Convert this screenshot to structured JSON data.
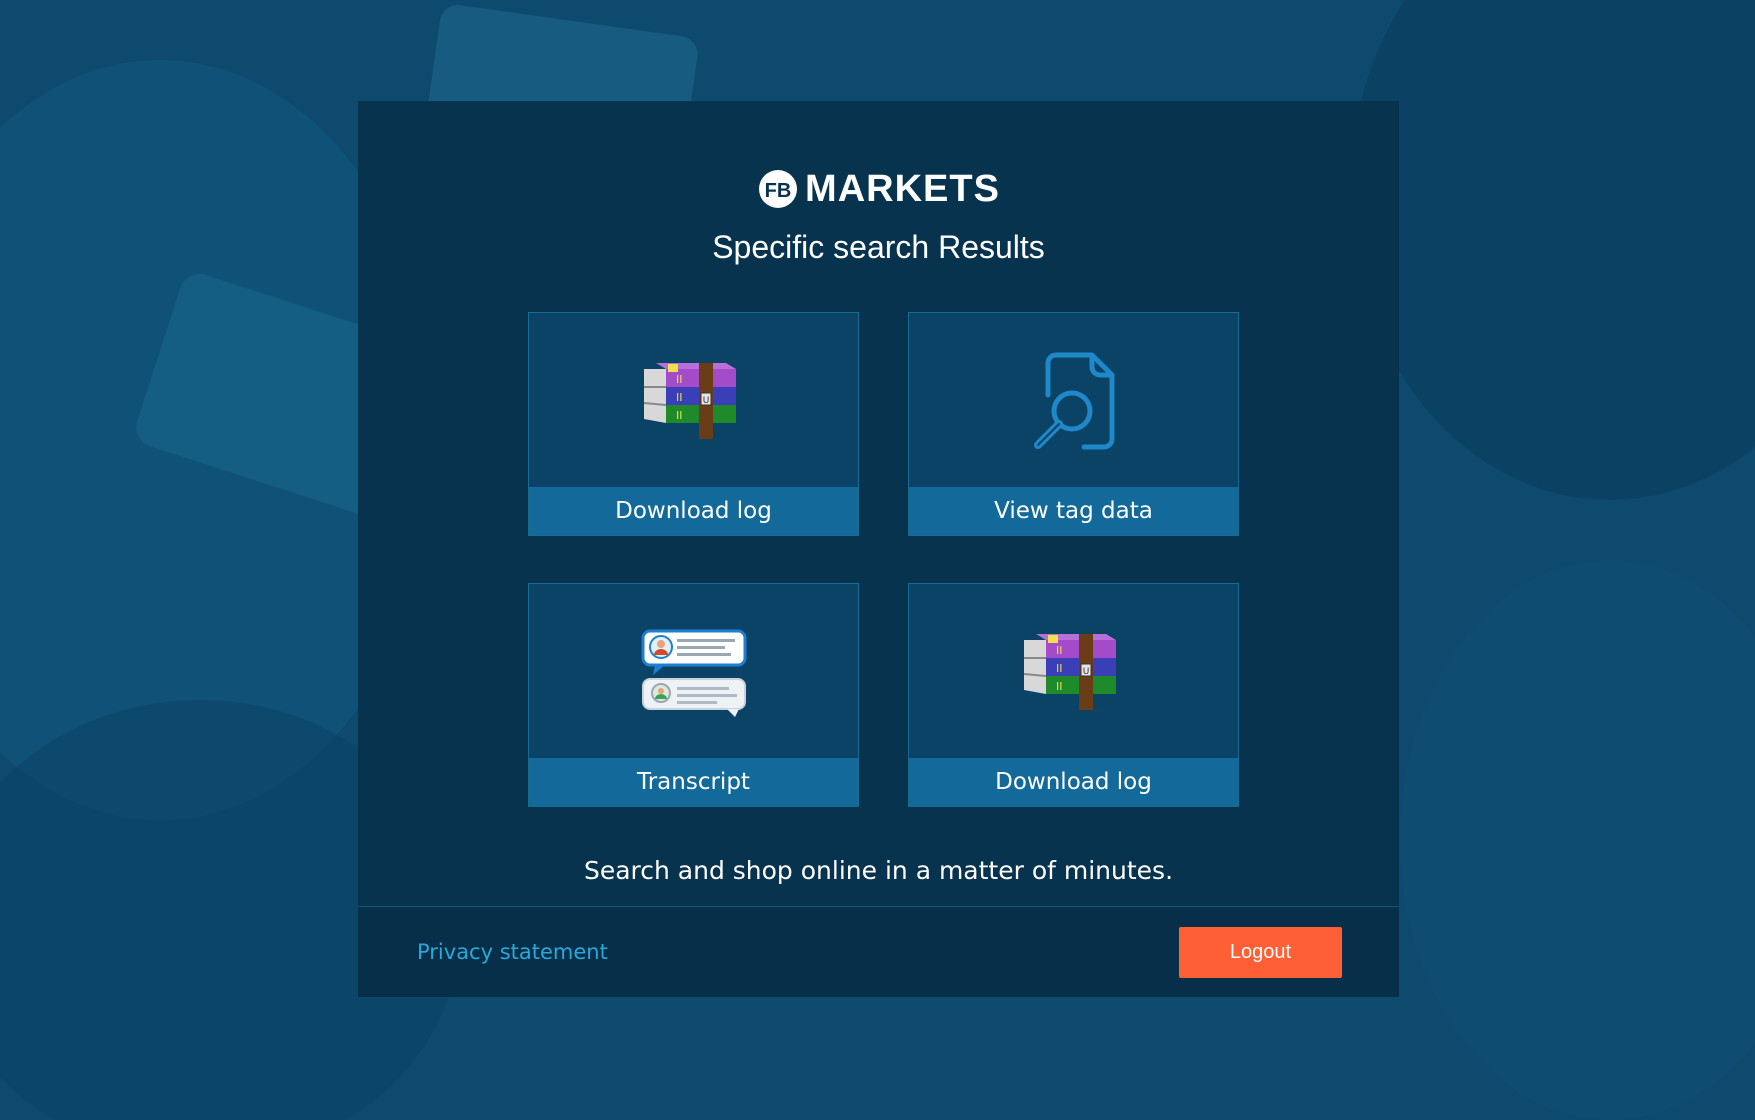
{
  "brand": {
    "name": "MARKETS",
    "logo_icon": "fb-circle-logo-icon"
  },
  "page": {
    "title": "Specific search Results"
  },
  "tiles": [
    {
      "label": "Download log",
      "icon": "winrar-archive-icon"
    },
    {
      "label": "View tag data",
      "icon": "document-search-icon"
    },
    {
      "label": "Transcript",
      "icon": "chat-transcript-icon"
    },
    {
      "label": "Download log",
      "icon": "winrar-archive-icon"
    }
  ],
  "tagline": "Search and shop online in a matter of minutes.",
  "footer": {
    "privacy_label": "Privacy statement",
    "logout_label": "Logout"
  },
  "colors": {
    "background": "#0d4a6e",
    "card": "#07334f",
    "tile_label": "#136a9a",
    "link": "#29a9d8",
    "logout": "#ff5f35"
  }
}
